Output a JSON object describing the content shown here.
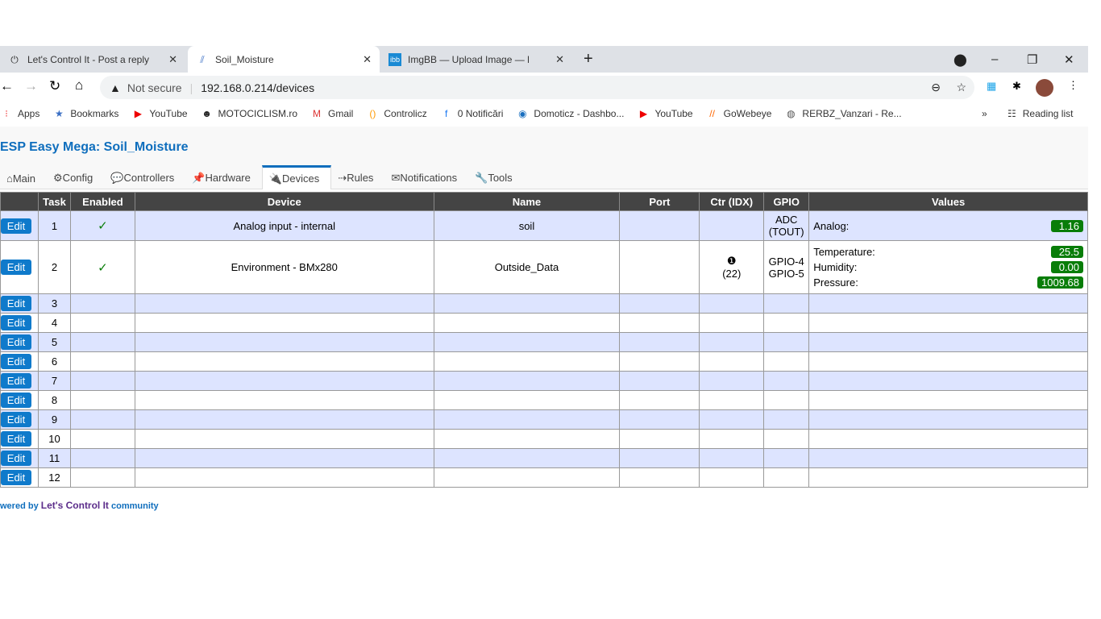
{
  "browser": {
    "tabs": [
      {
        "label": "Let's Control It - Post a reply",
        "icon": "lci-icon"
      },
      {
        "label": "Soil_Moisture",
        "icon": "esp-easy-icon",
        "active": true
      },
      {
        "label": "ImgBB — Upload Image — Free I",
        "icon": "imgbb-icon"
      }
    ],
    "security": "Not secure",
    "url": "192.168.0.214/devices",
    "bookmarks": [
      "Apps",
      "Bookmarks",
      "YouTube",
      "MOTOCICLISM.ro",
      "Gmail",
      "Controlicz",
      "0 Notificări",
      "Domoticz - Dashbo...",
      "YouTube",
      "GoWebeye",
      "RERBZ_Vanzari - Re..."
    ],
    "reading_list": "Reading list"
  },
  "page": {
    "title": "ESP Easy Mega: Soil_Moisture",
    "menu": [
      {
        "label": "⌂Main"
      },
      {
        "label": "⚙Config"
      },
      {
        "label": "💬Controllers"
      },
      {
        "label": "📌Hardware"
      },
      {
        "label": "🔌Devices",
        "active": true
      },
      {
        "label": "⇢Rules"
      },
      {
        "label": "✉Notifications"
      },
      {
        "label": "🔧Tools"
      }
    ],
    "columns": [
      "",
      "Task",
      "Enabled",
      "Device",
      "Name",
      "Port",
      "Ctr (IDX)",
      "GPIO",
      "Values"
    ],
    "edit_label": "Edit",
    "check": "✓",
    "rows": [
      {
        "task": "1",
        "enabled": true,
        "device": "Analog input - internal",
        "name": "soil",
        "port": "",
        "ctr": "",
        "idx": "",
        "gpio": [
          "ADC",
          "(TOUT)"
        ],
        "values": [
          {
            "label": "Analog:",
            "value": "1.16"
          }
        ]
      },
      {
        "task": "2",
        "enabled": true,
        "device": "Environment - BMx280",
        "name": "Outside_Data",
        "port": "",
        "ctr": "❶",
        "idx": "(22)",
        "gpio": [
          "GPIO-4",
          "GPIO-5"
        ],
        "values": [
          {
            "label": "Temperature:",
            "value": "25.5"
          },
          {
            "label": "Humidity:",
            "value": "0.00"
          },
          {
            "label": "Pressure:",
            "value": "1009.68"
          }
        ]
      },
      {
        "task": "3"
      },
      {
        "task": "4"
      },
      {
        "task": "5"
      },
      {
        "task": "6"
      },
      {
        "task": "7"
      },
      {
        "task": "8"
      },
      {
        "task": "9"
      },
      {
        "task": "10"
      },
      {
        "task": "11"
      },
      {
        "task": "12"
      }
    ],
    "footer": {
      "prefix": "wered by",
      "brand": "Let's Control It",
      "suffix": "community"
    }
  },
  "colors": {
    "accent": "#0f6ebd",
    "value_badge": "#087d08",
    "row_alt": "#dde4ff",
    "header": "#444444"
  }
}
